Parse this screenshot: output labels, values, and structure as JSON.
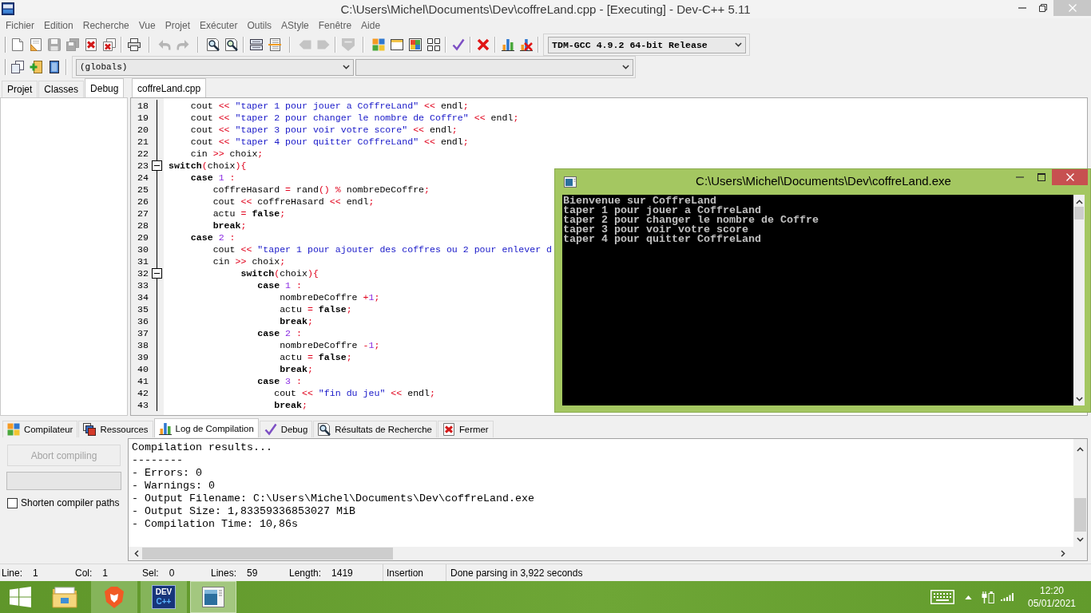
{
  "window": {
    "title": "C:\\Users\\Michel\\Documents\\Dev\\coffreLand.cpp - [Executing] - Dev-C++ 5.11",
    "active": false
  },
  "menu": [
    "Fichier",
    "Edition",
    "Recherche",
    "Vue",
    "Projet",
    "Exécuter",
    "Outils",
    "AStyle",
    "Fenêtre",
    "Aide"
  ],
  "main_toolbar": {
    "groups": [
      {
        "buttons": [
          {
            "disabled": false
          },
          {
            "disabled": false
          },
          {
            "disabled": true
          },
          {
            "disabled": true
          },
          {
            "disabled": false
          },
          {
            "disabled": false
          }
        ]
      },
      {
        "buttons": [
          {
            "disabled": false
          }
        ]
      },
      {
        "buttons": [
          {
            "disabled": true
          },
          {
            "disabled": true
          }
        ]
      },
      {
        "buttons": [
          {
            "disabled": false
          },
          {
            "disabled": false
          }
        ]
      },
      {
        "buttons": [
          {
            "disabled": false
          },
          {
            "disabled": false
          }
        ]
      },
      {
        "buttons": [
          {
            "disabled": true
          },
          {
            "disabled": true
          }
        ]
      },
      {
        "buttons": [
          {
            "disabled": true
          }
        ]
      },
      {
        "buttons": [
          {
            "disabled": false
          },
          {
            "disabled": false
          },
          {
            "disabled": false
          },
          {
            "disabled": false
          }
        ]
      },
      {
        "buttons": [
          {
            "disabled": false
          }
        ]
      },
      {
        "buttons": [
          {
            "disabled": false
          }
        ]
      },
      {
        "buttons": [
          {
            "disabled": false
          },
          {
            "disabled": false
          }
        ]
      }
    ],
    "compiler": {
      "value": "TDM-GCC 4.9.2 64-bit Release"
    }
  },
  "class_toolbar": {
    "buttons": [
      {
        "disabled": false
      },
      {
        "disabled": false
      },
      {
        "disabled": false
      }
    ],
    "selectors": [
      {
        "value": "(globals)",
        "disabled": false
      },
      {
        "disabled": false
      }
    ]
  },
  "side_panel": {
    "tabs": [
      {
        "label": "Projet",
        "selected": false
      },
      {
        "label": "Classes",
        "selected": false
      },
      {
        "label": "Debug",
        "selected": true
      }
    ]
  },
  "editor": {
    "tabs": [
      {
        "label": "coffreLand.cpp",
        "selected": true
      }
    ],
    "lines": [
      {
        "number": "18",
        "kind": "code",
        "tokens": [
          {
            "text": "    cout ",
            "kind": "plain"
          },
          {
            "text": "<< ",
            "kind": "symbol"
          },
          {
            "text": "\"taper 1 pour jouer a CoffreLand\" ",
            "kind": "string"
          },
          {
            "text": "<< ",
            "kind": "symbol"
          },
          {
            "text": "endl",
            "kind": "plain"
          },
          {
            "text": ";",
            "kind": "symbol"
          }
        ]
      },
      {
        "number": "19",
        "kind": "code",
        "tokens": [
          {
            "text": "    cout ",
            "kind": "plain"
          },
          {
            "text": "<< ",
            "kind": "symbol"
          },
          {
            "text": "\"taper 2 pour changer le nombre de Coffre\" ",
            "kind": "string"
          },
          {
            "text": "<< ",
            "kind": "symbol"
          },
          {
            "text": "endl",
            "kind": "plain"
          },
          {
            "text": ";",
            "kind": "symbol"
          }
        ]
      },
      {
        "number": "20",
        "kind": "code",
        "tokens": [
          {
            "text": "    cout ",
            "kind": "plain"
          },
          {
            "text": "<< ",
            "kind": "symbol"
          },
          {
            "text": "\"taper 3 pour voir votre score\" ",
            "kind": "string"
          },
          {
            "text": "<< ",
            "kind": "symbol"
          },
          {
            "text": "endl",
            "kind": "plain"
          },
          {
            "text": ";",
            "kind": "symbol"
          }
        ]
      },
      {
        "number": "21",
        "kind": "code",
        "tokens": [
          {
            "text": "    cout ",
            "kind": "plain"
          },
          {
            "text": "<< ",
            "kind": "symbol"
          },
          {
            "text": "\"taper 4 pour quitter CoffreLand\" ",
            "kind": "string"
          },
          {
            "text": "<< ",
            "kind": "symbol"
          },
          {
            "text": "endl",
            "kind": "plain"
          },
          {
            "text": ";",
            "kind": "symbol"
          }
        ]
      },
      {
        "number": "22",
        "kind": "code",
        "tokens": [
          {
            "text": "    cin ",
            "kind": "plain"
          },
          {
            "text": ">> ",
            "kind": "symbol"
          },
          {
            "text": "choix",
            "kind": "plain"
          },
          {
            "text": ";",
            "kind": "symbol"
          }
        ]
      },
      {
        "number": "23",
        "kind": "fold",
        "tokens": [
          {
            "text": "switch",
            "kind": "keyword"
          },
          {
            "text": "(",
            "kind": "symbol"
          },
          {
            "text": "choix",
            "kind": "plain"
          },
          {
            "text": "){",
            "kind": "symbol"
          }
        ]
      },
      {
        "number": "24",
        "kind": "code",
        "tokens": [
          {
            "text": "    case ",
            "kind": "keyword"
          },
          {
            "text": "1 ",
            "kind": "number"
          },
          {
            "text": ":",
            "kind": "symbol"
          }
        ]
      },
      {
        "number": "25",
        "kind": "code",
        "tokens": [
          {
            "text": "        coffreHasard ",
            "kind": "plain"
          },
          {
            "text": "= ",
            "kind": "symbol"
          },
          {
            "text": "rand",
            "kind": "plain"
          },
          {
            "text": "() % ",
            "kind": "symbol"
          },
          {
            "text": "nombreDeCoffre",
            "kind": "plain"
          },
          {
            "text": ";",
            "kind": "symbol"
          }
        ]
      },
      {
        "number": "26",
        "kind": "code",
        "tokens": [
          {
            "text": "        cout ",
            "kind": "plain"
          },
          {
            "text": "<< ",
            "kind": "symbol"
          },
          {
            "text": "coffreHasard ",
            "kind": "plain"
          },
          {
            "text": "<< ",
            "kind": "symbol"
          },
          {
            "text": "endl",
            "kind": "plain"
          },
          {
            "text": ";",
            "kind": "symbol"
          }
        ]
      },
      {
        "number": "27",
        "kind": "code",
        "tokens": [
          {
            "text": "        actu ",
            "kind": "plain"
          },
          {
            "text": "= ",
            "kind": "symbol"
          },
          {
            "text": "false",
            "kind": "keyword"
          },
          {
            "text": ";",
            "kind": "symbol"
          }
        ]
      },
      {
        "number": "28",
        "kind": "code",
        "tokens": [
          {
            "text": "        break",
            "kind": "keyword"
          },
          {
            "text": ";",
            "kind": "symbol"
          }
        ]
      },
      {
        "number": "29",
        "kind": "code",
        "tokens": [
          {
            "text": "    case ",
            "kind": "keyword"
          },
          {
            "text": "2 ",
            "kind": "number"
          },
          {
            "text": ":",
            "kind": "symbol"
          }
        ]
      },
      {
        "number": "30",
        "kind": "code",
        "tokens": [
          {
            "text": "        cout ",
            "kind": "plain"
          },
          {
            "text": "<< ",
            "kind": "symbol"
          },
          {
            "text": "\"taper 1 pour ajouter des coffres ou 2 pour enlever d",
            "kind": "string"
          }
        ]
      },
      {
        "number": "31",
        "kind": "code",
        "tokens": [
          {
            "text": "        cin ",
            "kind": "plain"
          },
          {
            "text": ">> ",
            "kind": "symbol"
          },
          {
            "text": "choix",
            "kind": "plain"
          },
          {
            "text": ";",
            "kind": "symbol"
          }
        ]
      },
      {
        "number": "32",
        "kind": "fold",
        "tokens": [
          {
            "text": "             switch",
            "kind": "keyword"
          },
          {
            "text": "(",
            "kind": "symbol"
          },
          {
            "text": "choix",
            "kind": "plain"
          },
          {
            "text": "){",
            "kind": "symbol"
          }
        ]
      },
      {
        "number": "33",
        "kind": "code",
        "tokens": [
          {
            "text": "                case ",
            "kind": "keyword"
          },
          {
            "text": "1 ",
            "kind": "number"
          },
          {
            "text": ":",
            "kind": "symbol"
          }
        ]
      },
      {
        "number": "34",
        "kind": "code",
        "tokens": [
          {
            "text": "                    nombreDeCoffre ",
            "kind": "plain"
          },
          {
            "text": "+",
            "kind": "symbol"
          },
          {
            "text": "1",
            "kind": "number"
          },
          {
            "text": ";",
            "kind": "symbol"
          }
        ]
      },
      {
        "number": "35",
        "kind": "code",
        "tokens": [
          {
            "text": "                    actu ",
            "kind": "plain"
          },
          {
            "text": "= ",
            "kind": "symbol"
          },
          {
            "text": "false",
            "kind": "keyword"
          },
          {
            "text": ";",
            "kind": "symbol"
          }
        ]
      },
      {
        "number": "36",
        "kind": "code",
        "tokens": [
          {
            "text": "                    break",
            "kind": "keyword"
          },
          {
            "text": ";",
            "kind": "symbol"
          }
        ]
      },
      {
        "number": "37",
        "kind": "code",
        "tokens": [
          {
            "text": "                case ",
            "kind": "keyword"
          },
          {
            "text": "2 ",
            "kind": "number"
          },
          {
            "text": ":",
            "kind": "symbol"
          }
        ]
      },
      {
        "number": "38",
        "kind": "code",
        "tokens": [
          {
            "text": "                    nombreDeCoffre ",
            "kind": "plain"
          },
          {
            "text": "-",
            "kind": "symbol"
          },
          {
            "text": "1",
            "kind": "number"
          },
          {
            "text": ";",
            "kind": "symbol"
          }
        ]
      },
      {
        "number": "39",
        "kind": "code",
        "tokens": [
          {
            "text": "                    actu ",
            "kind": "plain"
          },
          {
            "text": "= ",
            "kind": "symbol"
          },
          {
            "text": "false",
            "kind": "keyword"
          },
          {
            "text": ";",
            "kind": "symbol"
          }
        ]
      },
      {
        "number": "40",
        "kind": "code",
        "tokens": [
          {
            "text": "                    break",
            "kind": "keyword"
          },
          {
            "text": ";",
            "kind": "symbol"
          }
        ]
      },
      {
        "number": "41",
        "kind": "code",
        "tokens": [
          {
            "text": "                case ",
            "kind": "keyword"
          },
          {
            "text": "3 ",
            "kind": "number"
          },
          {
            "text": ":",
            "kind": "symbol"
          }
        ]
      },
      {
        "number": "42",
        "kind": "code",
        "tokens": [
          {
            "text": "                   cout ",
            "kind": "plain"
          },
          {
            "text": "<< ",
            "kind": "symbol"
          },
          {
            "text": "\"fin du jeu\" ",
            "kind": "string"
          },
          {
            "text": "<< ",
            "kind": "symbol"
          },
          {
            "text": "endl",
            "kind": "plain"
          },
          {
            "text": ";",
            "kind": "symbol"
          }
        ]
      },
      {
        "number": "43",
        "kind": "code",
        "tokens": [
          {
            "text": "                   break",
            "kind": "keyword"
          },
          {
            "text": ";",
            "kind": "symbol"
          }
        ]
      }
    ]
  },
  "console_window": {
    "title": "C:\\Users\\Michel\\Documents\\Dev\\coffreLand.exe",
    "active": true,
    "lines": [
      "Bienvenue sur CoffreLand",
      "taper 1 pour jouer a CoffreLand",
      "taper 2 pour changer le nombre de Coffre",
      "taper 3 pour voir votre score",
      "taper 4 pour quitter CoffreLand"
    ]
  },
  "bottom_panel": {
    "tabs": [
      {
        "label": "Compilateur",
        "selected": false
      },
      {
        "label": "Ressources",
        "selected": false
      },
      {
        "label": "Log de Compilation",
        "selected": true
      },
      {
        "label": "Debug",
        "selected": false
      },
      {
        "label": "Résultats de Recherche",
        "selected": false
      },
      {
        "label": "Fermer",
        "selected": false
      }
    ],
    "abort_button": {
      "label": "Abort compiling",
      "disabled": true
    },
    "progress": {
      "level": 0
    },
    "shorten_paths": {
      "label": "Shorten compiler paths",
      "checked": false
    },
    "log": [
      "Compilation results...",
      "--------",
      "- Errors: 0",
      "- Warnings: 0",
      "- Output Filename: C:\\Users\\Michel\\Documents\\Dev\\coffreLand.exe",
      "- Output Size: 1,83359336853027 MiB",
      "- Compilation Time: 10,86s"
    ]
  },
  "status_bar": [
    {
      "label": "Line:",
      "value": "1"
    },
    {
      "label": "Col:",
      "value": "1"
    },
    {
      "label": "Sel:",
      "value": "0"
    },
    {
      "label": "Lines:",
      "value": "59"
    },
    {
      "label": "Length:",
      "value": "1419"
    },
    {
      "value": "Insertion"
    },
    {
      "value": "Done parsing in 3,922 seconds"
    }
  ],
  "taskbar": {
    "apps": [
      {
        "open": false,
        "selected": false
      },
      {
        "open": true,
        "selected": false
      },
      {
        "open": true,
        "selected": false,
        "logo_text": [
          "DEV",
          "C++"
        ]
      },
      {
        "open": true,
        "selected": true
      }
    ],
    "clock": {
      "time": "12:20",
      "date": "05/01/2021"
    }
  }
}
